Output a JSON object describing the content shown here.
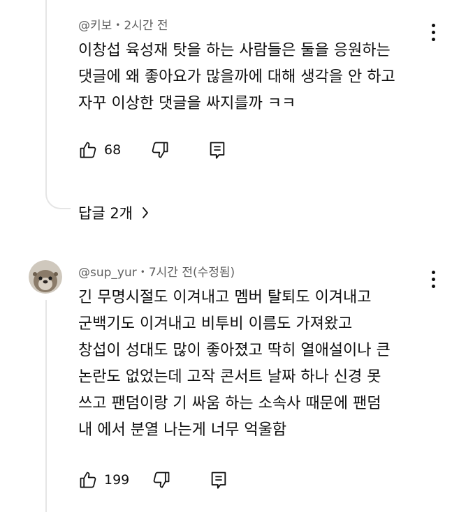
{
  "comments": [
    {
      "author": "@키보",
      "separator": "•",
      "time": "2시간 전",
      "lines": [
        "이창섭 육성재 탓을 하는 사람들은 둘을 응원하는",
        "댓글에 왜 좋아요가 많을까에 대해 생각을 안 하고",
        "자꾸 이상한 댓글을 싸지를까 ㅋㅋ"
      ],
      "likes": "68",
      "replies_label": "답글 2개",
      "replies_chevron": "›"
    },
    {
      "author": "@sup_yur",
      "separator": "•",
      "time": "7시간 전(수정됨)",
      "lines": [
        "긴 무명시절도 이겨내고 멤버 탈퇴도 이겨내고",
        "군백기도 이겨내고 비투비 이름도 가져왔고",
        "창섭이 성대도 많이 좋아졌고 딱히 열애설이나 큰",
        "논란도 없었는데 고작 콘서트 날짜 하나 신경 못",
        "쓰고 팬덤이랑 기 싸움 하는 소속사 때문에 팬덤",
        "내 에서 분열 나는게 너무 억울함"
      ],
      "likes": "199",
      "avatar": "otter-avatar"
    }
  ],
  "icons": [
    "more-vert-icon",
    "thumb-up-icon",
    "thumb-down-icon",
    "comment-icon",
    "chevron-right-icon"
  ]
}
